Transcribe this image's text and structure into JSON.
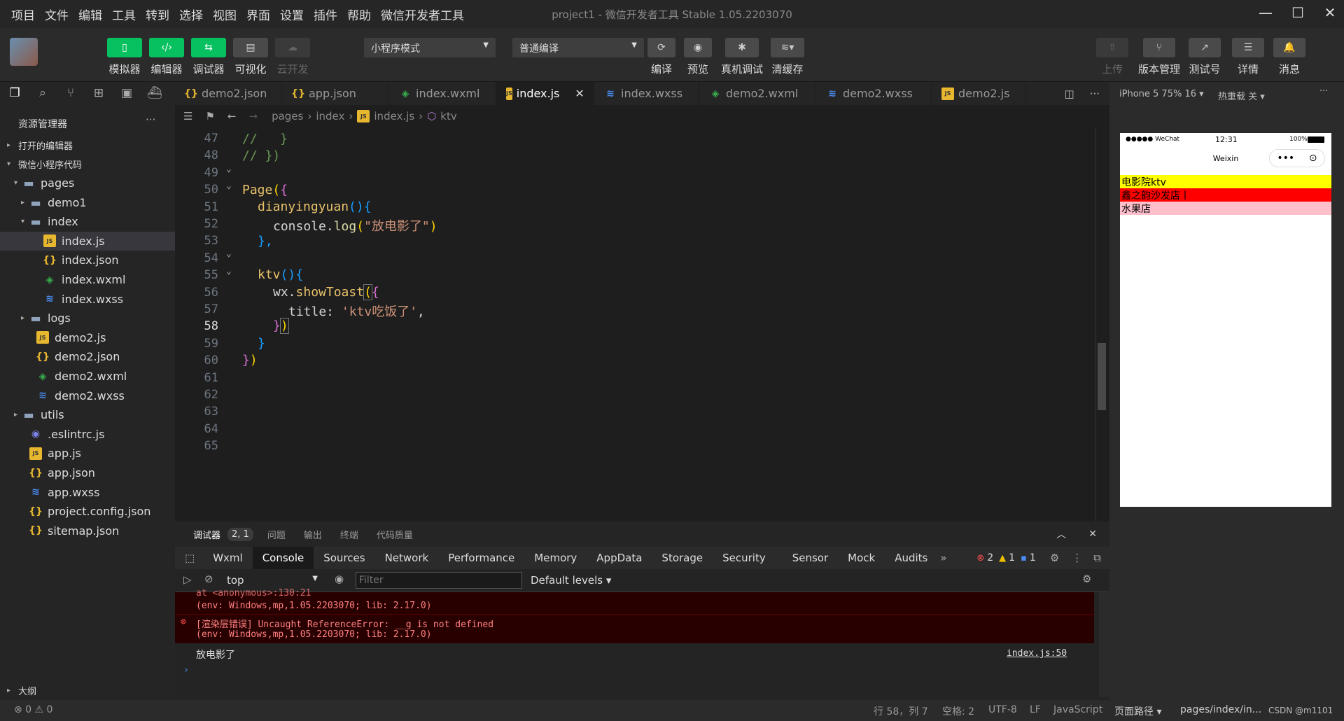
{
  "menu": [
    "项目",
    "文件",
    "编辑",
    "工具",
    "转到",
    "选择",
    "视图",
    "界面",
    "设置",
    "插件",
    "帮助",
    "微信开发者工具"
  ],
  "window_title": "project1 - 微信开发者工具 Stable 1.05.2203070",
  "toolbar": {
    "simulator": "模拟器",
    "editor": "编辑器",
    "debugger": "调试器",
    "visual": "可视化",
    "cloud": "云开发",
    "mode": "小程序模式",
    "compile_mode": "普通编译",
    "compile": "编译",
    "preview": "预览",
    "remote_debug": "真机调试",
    "clear_cache": "清缓存",
    "upload": "上传",
    "version": "版本管理",
    "test_account": "测试号",
    "details": "详情",
    "messages": "消息"
  },
  "explorer": {
    "title": "资源管理器",
    "open_editors": "打开的编辑器",
    "project": "微信小程序代码",
    "outline": "大纲",
    "items": [
      {
        "name": "pages",
        "icon": "folder-icon",
        "arrow": "▾"
      },
      {
        "name": "demo1",
        "icon": "folder-icon",
        "arrow": "▸"
      },
      {
        "name": "index",
        "icon": "folder-icon",
        "arrow": "▾"
      },
      {
        "name": "index.js",
        "icon": "js-file-icon",
        "arrow": ""
      },
      {
        "name": "index.json",
        "icon": "json-file-icon",
        "arrow": ""
      },
      {
        "name": "index.wxml",
        "icon": "wxml-file-icon",
        "arrow": ""
      },
      {
        "name": "index.wxss",
        "icon": "wxss-file-icon",
        "arrow": ""
      },
      {
        "name": "logs",
        "icon": "folder-icon",
        "arrow": "▸"
      },
      {
        "name": "demo2.js",
        "icon": "js-file-icon",
        "arrow": ""
      },
      {
        "name": "demo2.json",
        "icon": "json-file-icon",
        "arrow": ""
      },
      {
        "name": "demo2.wxml",
        "icon": "wxml-file-icon",
        "arrow": ""
      },
      {
        "name": "demo2.wxss",
        "icon": "wxss-file-icon",
        "arrow": ""
      },
      {
        "name": "utils",
        "icon": "folder-icon",
        "arrow": "▸"
      },
      {
        "name": ".eslintrc.js",
        "icon": "eslint-icon",
        "arrow": ""
      },
      {
        "name": "app.js",
        "icon": "js-file-icon",
        "arrow": ""
      },
      {
        "name": "app.json",
        "icon": "json-file-icon",
        "arrow": ""
      },
      {
        "name": "app.wxss",
        "icon": "wxss-file-icon",
        "arrow": ""
      },
      {
        "name": "project.config.json",
        "icon": "json-file-icon",
        "arrow": ""
      },
      {
        "name": "sitemap.json",
        "icon": "json-file-icon",
        "arrow": ""
      }
    ]
  },
  "tabs": [
    {
      "label": "demo2.json",
      "icon": "json-file-icon"
    },
    {
      "label": "app.json",
      "icon": "json-file-icon"
    },
    {
      "label": "index.wxml",
      "icon": "wxml-file-icon"
    },
    {
      "label": "index.js",
      "icon": "js-file-icon"
    },
    {
      "label": "index.wxss",
      "icon": "wxss-file-icon"
    },
    {
      "label": "demo2.wxml",
      "icon": "wxml-file-icon"
    },
    {
      "label": "demo2.wxss",
      "icon": "wxss-file-icon"
    },
    {
      "label": "demo2.js",
      "icon": "js-file-icon"
    }
  ],
  "breadcrumb": {
    "p1": "pages",
    "p2": "index",
    "p3": "index.js",
    "p4": "ktv"
  },
  "code": {
    "line_numbers": [
      "47",
      "48",
      "49",
      "50",
      "51",
      "52",
      "53",
      "54",
      "55",
      "56",
      "57",
      "58",
      "59",
      "60",
      "61",
      "62",
      "63",
      "64",
      "65"
    ],
    "l47": "//   }",
    "l48": "// })",
    "l50_a": "Page",
    "l50_b": "(",
    "l50_c": "{",
    "l51_a": "dianyingyuan",
    "l51_b": "(){",
    "l52_a": "console.",
    "l52_b": "log",
    "l52_c": "(",
    "l52_d": "\"放电影了\"",
    "l52_e": ")",
    "l53": "},",
    "l55_a": "ktv",
    "l55_b": "(){",
    "l56_a": "wx.",
    "l56_b": "showToast",
    "l56_c": "(",
    "l56_d": "{",
    "l57_a": "title: ",
    "l57_b": "'ktv吃饭了'",
    "l57_c": ",",
    "l58_a": "}",
    "l58_b": ")",
    "l59": "}",
    "l60_a": "}",
    "l60_b": ")"
  },
  "simulator": {
    "device": "iPhone 5 75% 16 ▾",
    "hot_reload": "热重载 关 ▾",
    "carrier": "●●●●● WeChat",
    "time": "12:31",
    "battery": "100%",
    "nav_title": "Weixin",
    "rows": [
      {
        "text": "电影院ktv",
        "color": "#ffff00"
      },
      {
        "text": "鑫之韵沙发店丨",
        "color": "#ff0000"
      },
      {
        "text": "水果店",
        "color": "#ffc0cb"
      }
    ]
  },
  "panel": {
    "tabs": [
      "调试器",
      "2, 1",
      "问题",
      "输出",
      "终端",
      "代码质量"
    ],
    "devtools_tabs": [
      "Wxml",
      "Console",
      "Sources",
      "Network",
      "Performance",
      "Memory",
      "AppData",
      "Storage",
      "Security",
      "Sensor",
      "Mock",
      "Audits"
    ],
    "errors": "2",
    "warnings": "1",
    "infos": "1",
    "context": "top",
    "filter_placeholder": "Filter",
    "levels": "Default levels ▾"
  },
  "console": {
    "trunc": "at <anonymous>:130:21",
    "env1": "(env: Windows,mp,1.05.2203070; lib: 2.17.0)",
    "err2": "[渲染层错误] Uncaught ReferenceError: __g is not defined",
    "env2": "(env: Windows,mp,1.05.2203070; lib: 2.17.0)",
    "log": "放电影了",
    "source": "index.js:50"
  },
  "status": {
    "problems": "⊗ 0 ⚠ 0",
    "position": "行 58，列 7",
    "spaces": "空格: 2",
    "encoding": "UTF-8",
    "eol": "LF",
    "language": "JavaScript",
    "page_path_label": "页面路径 ▾",
    "page_path": "pages/index/in...",
    "watermark": "CSDN @m1101"
  }
}
